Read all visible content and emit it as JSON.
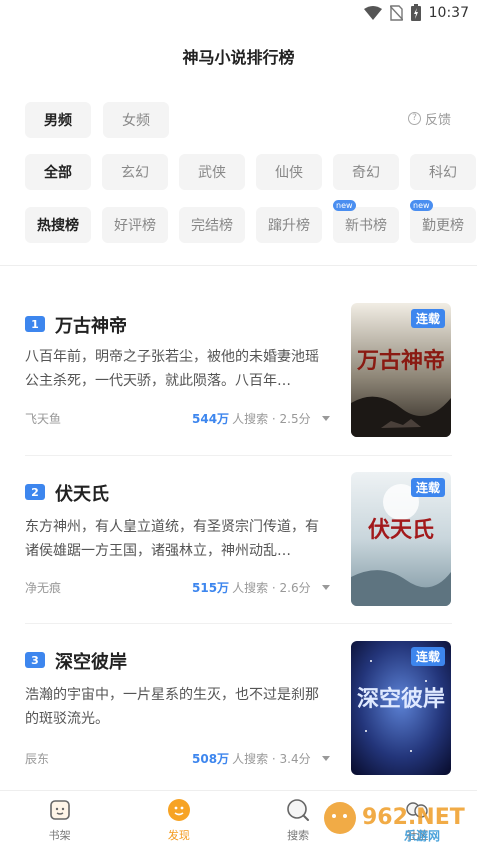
{
  "status_bar": {
    "time": "10:37"
  },
  "header": {
    "title": "神马小说排行榜"
  },
  "gender_tabs": [
    {
      "label": "男频",
      "active": true
    },
    {
      "label": "女频",
      "active": false
    }
  ],
  "feedback": {
    "label": "反馈"
  },
  "genres": [
    {
      "label": "全部",
      "active": true
    },
    {
      "label": "玄幻",
      "active": false
    },
    {
      "label": "武侠",
      "active": false
    },
    {
      "label": "仙侠",
      "active": false
    },
    {
      "label": "奇幻",
      "active": false
    },
    {
      "label": "科幻",
      "active": false
    }
  ],
  "rank_types": [
    {
      "label": "热搜榜",
      "active": true,
      "new": false
    },
    {
      "label": "好评榜",
      "active": false,
      "new": false
    },
    {
      "label": "完结榜",
      "active": false,
      "new": false
    },
    {
      "label": "蹿升榜",
      "active": false,
      "new": false
    },
    {
      "label": "新书榜",
      "active": false,
      "new": true
    },
    {
      "label": "勤更榜",
      "active": false,
      "new": true
    }
  ],
  "new_badge": "new",
  "books": [
    {
      "rank": "1",
      "title": "万古神帝",
      "desc": "八百年前，明帝之子张若尘，被他的未婚妻池瑶公主杀死，一代天骄，就此陨落。八百年…",
      "author": "飞天鱼",
      "hot": "544万",
      "stats": "人搜索 · 2.5分",
      "tag": "连载",
      "cover_text": "万古神帝"
    },
    {
      "rank": "2",
      "title": "伏天氏",
      "desc": "东方神州，有人皇立道统，有圣贤宗门传道，有诸侯雄踞一方王国，诸强林立，神州动乱…",
      "author": "净无痕",
      "hot": "515万",
      "stats": "人搜索 · 2.6分",
      "tag": "连载",
      "cover_text": "伏天氏"
    },
    {
      "rank": "3",
      "title": "深空彼岸",
      "desc": "浩瀚的宇宙中，一片星系的生灭，也不过是刹那的斑驳流光。",
      "author": "辰东",
      "hot": "508万",
      "stats": "人搜索 · 3.4分",
      "tag": "连载",
      "cover_text": "深空彼岸"
    }
  ],
  "bottom_nav": [
    {
      "label": "书架",
      "icon": "bookshelf-icon",
      "active": false
    },
    {
      "label": "发现",
      "icon": "discover-icon",
      "active": true
    },
    {
      "label": "搜索",
      "icon": "search-icon",
      "active": false
    },
    {
      "label": "社区",
      "icon": "community-icon",
      "active": false
    }
  ],
  "watermark": {
    "text": "962.NET",
    "subtext": "乐游网"
  },
  "colors": {
    "accent": "#3d86ee",
    "nav_active": "#f39a1d"
  }
}
